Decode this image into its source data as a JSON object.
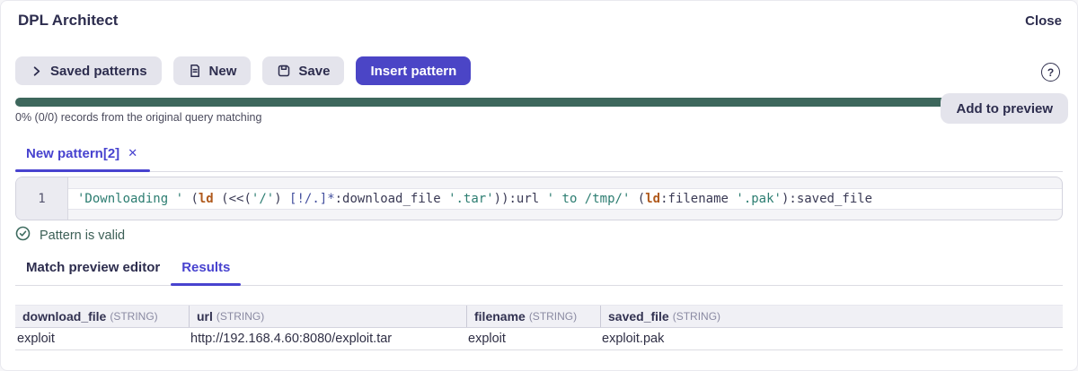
{
  "header": {
    "title": "DPL Architect",
    "close_label": "Close"
  },
  "toolbar": {
    "saved_patterns_label": "Saved patterns",
    "new_label": "New",
    "save_label": "Save",
    "insert_pattern_label": "Insert pattern",
    "help_glyph": "?"
  },
  "progress": {
    "percent_filled": 98,
    "status_text": "0% (0/0) records from the original query matching",
    "add_to_preview_label": "Add to preview"
  },
  "pattern_tab": {
    "label": "New pattern[2]",
    "close_glyph": "✕"
  },
  "editor": {
    "line_number": "1",
    "code_full": "'Downloading ' (ld (<<('/') [!/.]*:download_file '.tar')):url ' to /tmp/' (ld:filename '.pak'):saved_file",
    "tokens": [
      {
        "t": "'Downloading '",
        "c": "string"
      },
      {
        "t": " (",
        "c": "plain"
      },
      {
        "t": "ld",
        "c": "keyword"
      },
      {
        "t": " (<<(",
        "c": "plain"
      },
      {
        "t": "'/'",
        "c": "string"
      },
      {
        "t": ") ",
        "c": "plain"
      },
      {
        "t": "[!/.]*",
        "c": "charclass"
      },
      {
        "t": ":download_file ",
        "c": "plain"
      },
      {
        "t": "'.tar'",
        "c": "string"
      },
      {
        "t": ")):url ",
        "c": "plain"
      },
      {
        "t": "' to /tmp/'",
        "c": "string"
      },
      {
        "t": " (",
        "c": "plain"
      },
      {
        "t": "ld",
        "c": "keyword"
      },
      {
        "t": ":filename ",
        "c": "plain"
      },
      {
        "t": "'.pak'",
        "c": "string"
      },
      {
        "t": "):saved_file",
        "c": "plain"
      }
    ]
  },
  "validation": {
    "message": "Pattern is valid"
  },
  "preview_tabs": {
    "match_editor_label": "Match preview editor",
    "results_label": "Results"
  },
  "results_table": {
    "columns": [
      {
        "name": "download_file",
        "type": "(STRING)"
      },
      {
        "name": "url",
        "type": "(STRING)"
      },
      {
        "name": "filename",
        "type": "(STRING)"
      },
      {
        "name": "saved_file",
        "type": "(STRING)"
      }
    ],
    "rows": [
      [
        "exploit",
        "http://192.168.4.60:8080/exploit.tar",
        "exploit",
        "exploit.pak"
      ]
    ]
  },
  "colors": {
    "accent_indigo": "#4b45c6",
    "progress_green": "#3d675c",
    "valid_green": "#3d6b5f",
    "string_teal": "#2c7d71",
    "keyword_orange": "#b05a1d"
  }
}
